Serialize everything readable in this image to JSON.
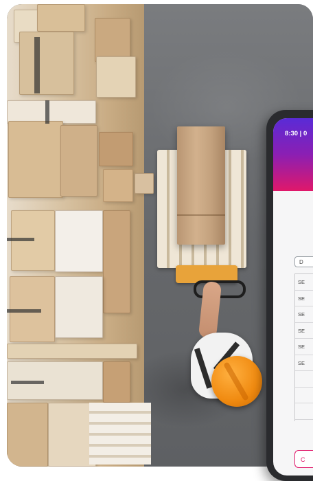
{
  "phone": {
    "status_time": "8:30 | 0",
    "filter_button_label": "D",
    "table_rows": [
      "SE",
      "SE",
      "SE",
      "SE",
      "SE",
      "SE",
      "",
      "",
      ""
    ],
    "footer_button_label": "C"
  },
  "colors": {
    "header_gradient_start": "#5a2bd6",
    "header_gradient_end": "#e0186a",
    "accent": "#e0186a",
    "helmet": "#f08a10"
  }
}
